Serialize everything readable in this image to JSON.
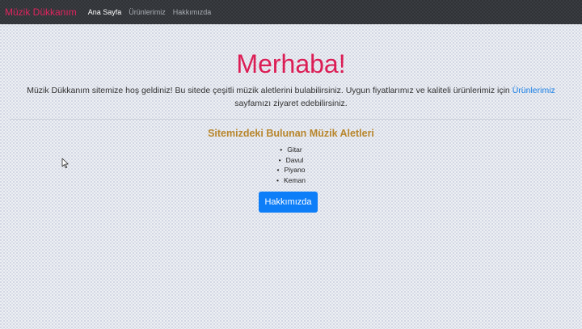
{
  "navbar": {
    "brand": "Müzik Dükkanım",
    "links": [
      "Ana Sayfa",
      "Ürünlerimiz",
      "Hakkımızda"
    ]
  },
  "hero": {
    "title": "Merhaba!",
    "lead_before": "Müzik Dükkanım sitemize hoş geldiniz! Bu sitede çeşitli müzik aletlerini bulabilirsiniz. Uygun fiyatlarımız ve kaliteli ürünlerimiz için ",
    "lead_link": "Ürünlerimiz",
    "lead_after": " sayfamızı ziyaret edebilirsiniz."
  },
  "instruments": {
    "title": "Sitemizdeki Bulunan Müzik Aletleri",
    "items": [
      "Gitar",
      "Davul",
      "Piyano",
      "Keman"
    ]
  },
  "about_button": "Hakkımızda",
  "colors": {
    "brand": "#e0245e",
    "title": "#dc1d55",
    "section_title": "#b8862c",
    "link": "#1a80e6",
    "button": "#0d7ef8"
  }
}
